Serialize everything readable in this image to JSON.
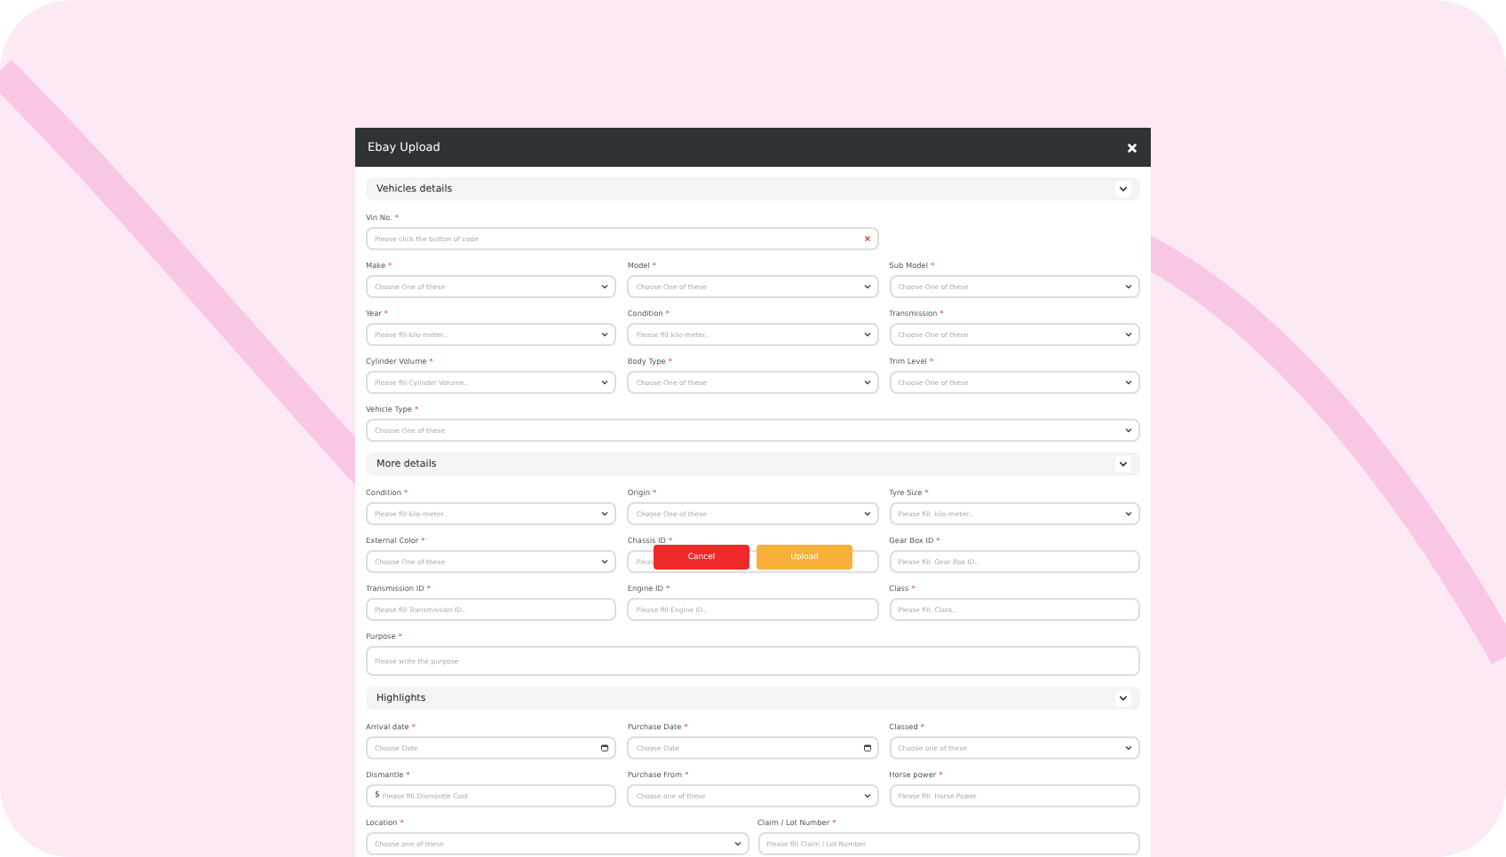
{
  "modal": {
    "title": "Ebay Upload"
  },
  "sections": [
    {
      "title": "Vehicles details",
      "expanded": true,
      "rows": [
        [
          {
            "kind": "vin",
            "label": "Vin No.",
            "mark": "*",
            "placeholder": "Please click the button of code"
          }
        ],
        [
          {
            "kind": "select",
            "label": "Make",
            "mark": "*",
            "placeholder": "Choose One of these"
          },
          {
            "kind": "select",
            "label": "Model",
            "mark": "*",
            "placeholder": "Choose One of these"
          },
          {
            "kind": "select",
            "label": "Sub Model",
            "mark": "*",
            "placeholder": "Choose One of these"
          }
        ],
        [
          {
            "kind": "select",
            "label": "Year",
            "mark": "*",
            "placeholder": "Please fill kilo-meter.."
          },
          {
            "kind": "select",
            "label": "Condition",
            "mark": "*",
            "placeholder": "Please fill kilo-meter.."
          },
          {
            "kind": "select",
            "label": "Transmission",
            "mark": "*",
            "placeholder": "Choose One of these"
          }
        ],
        [
          {
            "kind": "select",
            "label": "Cylinder Volume",
            "mark": "*",
            "placeholder": "Please fill Cylinder Volume.."
          },
          {
            "kind": "select",
            "label": "Body Type",
            "mark": "*",
            "placeholder": "Choose One of these"
          },
          {
            "kind": "select",
            "label": "Trim Level",
            "mark": "*",
            "placeholder": "Choose One of these"
          }
        ],
        [
          {
            "kind": "select",
            "label": "Vehicle Type",
            "mark": "*",
            "placeholder": "Choose One of these"
          }
        ]
      ]
    },
    {
      "title": "More details",
      "expanded": true,
      "rows": [
        [
          {
            "kind": "select",
            "label": "Condition",
            "mark": "*",
            "placeholder": "Please fill kilo-meter.."
          },
          {
            "kind": "select",
            "label": "Origin",
            "mark": "*",
            "placeholder": "Choose One of these"
          },
          {
            "kind": "select",
            "label": "Tyre Size",
            "mark": "*",
            "placeholder": "Please fill. kilo-meter.."
          }
        ],
        [
          {
            "kind": "select",
            "label": "External Color",
            "mark": "*",
            "placeholder": "Choose One of these"
          },
          {
            "kind": "text",
            "label": "Chassis ID",
            "mark": "*",
            "placeholder": "Pleas"
          },
          {
            "kind": "text",
            "label": "Gear Box ID",
            "mark": "*",
            "placeholder": "Please fill. Gear Box ID.."
          }
        ],
        [
          {
            "kind": "text",
            "label": "Transmission ID",
            "mark": "*",
            "placeholder": "Please fill Transmission ID.."
          },
          {
            "kind": "text",
            "label": "Engine ID",
            "mark": "*",
            "placeholder": "Please fill Engine ID.."
          },
          {
            "kind": "text",
            "label": "Class",
            "mark": "*",
            "placeholder": "Please fill. Class.."
          }
        ],
        [
          {
            "kind": "textarea",
            "label": "Purpose",
            "mark": "*",
            "placeholder": "Please write the purpose"
          }
        ]
      ]
    },
    {
      "title": "Highlights",
      "expanded": true,
      "rows": [
        [
          {
            "kind": "date",
            "label": "Arrival date",
            "mark": "*",
            "placeholder": "Choose Date"
          },
          {
            "kind": "date",
            "label": "Purchase Date",
            "mark": "*",
            "placeholder": "Choose Date"
          },
          {
            "kind": "select",
            "label": "Classed",
            "mark": "*",
            "placeholder": "Choose one of these"
          }
        ],
        [
          {
            "kind": "currency",
            "label": "Dismantle",
            "mark": "*",
            "prefix": "$",
            "placeholder": "Please fill Dismantle Cost"
          },
          {
            "kind": "select",
            "label": "Purchase From",
            "mark": "*",
            "placeholder": "Choose one of these"
          },
          {
            "kind": "text",
            "label": "Horse power",
            "mark": "*",
            "placeholder": "Please fill. Horse Power"
          }
        ],
        [
          {
            "kind": "select",
            "label": "Location",
            "mark": "*",
            "placeholder": "Choose one of these"
          },
          {
            "kind": "text",
            "label": "Claim / Lot Number",
            "mark": "*",
            "placeholder": "Please fill Claim / Lot Number"
          }
        ]
      ]
    }
  ],
  "buttons": [
    {
      "kind": "cancel",
      "label": "Cancel"
    },
    {
      "kind": "upload",
      "label": "Upload"
    }
  ]
}
